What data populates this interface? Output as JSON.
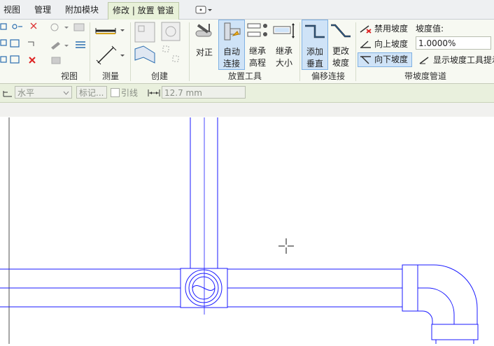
{
  "tabs": [
    {
      "label": "视图"
    },
    {
      "label": "管理"
    },
    {
      "label": "附加模块"
    },
    {
      "label": "修改 | 放置 管道"
    }
  ],
  "ribbon": {
    "groups": {
      "view": "视图",
      "measure": "测量",
      "create": "创建",
      "placement_tools": "放置工具",
      "offset_connections": "偏移连接",
      "sloped_piping": "带坡度管道"
    },
    "buttons": {
      "align": "对正",
      "auto_connect_1": "自动",
      "auto_connect_2": "连接",
      "inherit_elev_1": "继承",
      "inherit_elev_2": "高程",
      "inherit_size_1": "继承",
      "inherit_size_2": "大小",
      "add_vertical_1": "添加",
      "add_vertical_2": "垂直",
      "change_slope_1": "更改",
      "change_slope_2": "坡度"
    },
    "slope": {
      "disable": "禁用坡度",
      "up": "向上坡度",
      "down": "向下坡度",
      "value_label": "坡度值:",
      "value": "1.0000%",
      "show_tool": "显示坡度工具提示"
    }
  },
  "options_bar": {
    "orientation": "水平",
    "tag_placeholder": "标记...",
    "leader_label": "引线",
    "length_value": "12.7 mm"
  },
  "colors": {
    "pipe_line": "#1a1aff",
    "ribbon_bg": "#f7f9f2",
    "active_button": "#cfe3f7"
  }
}
